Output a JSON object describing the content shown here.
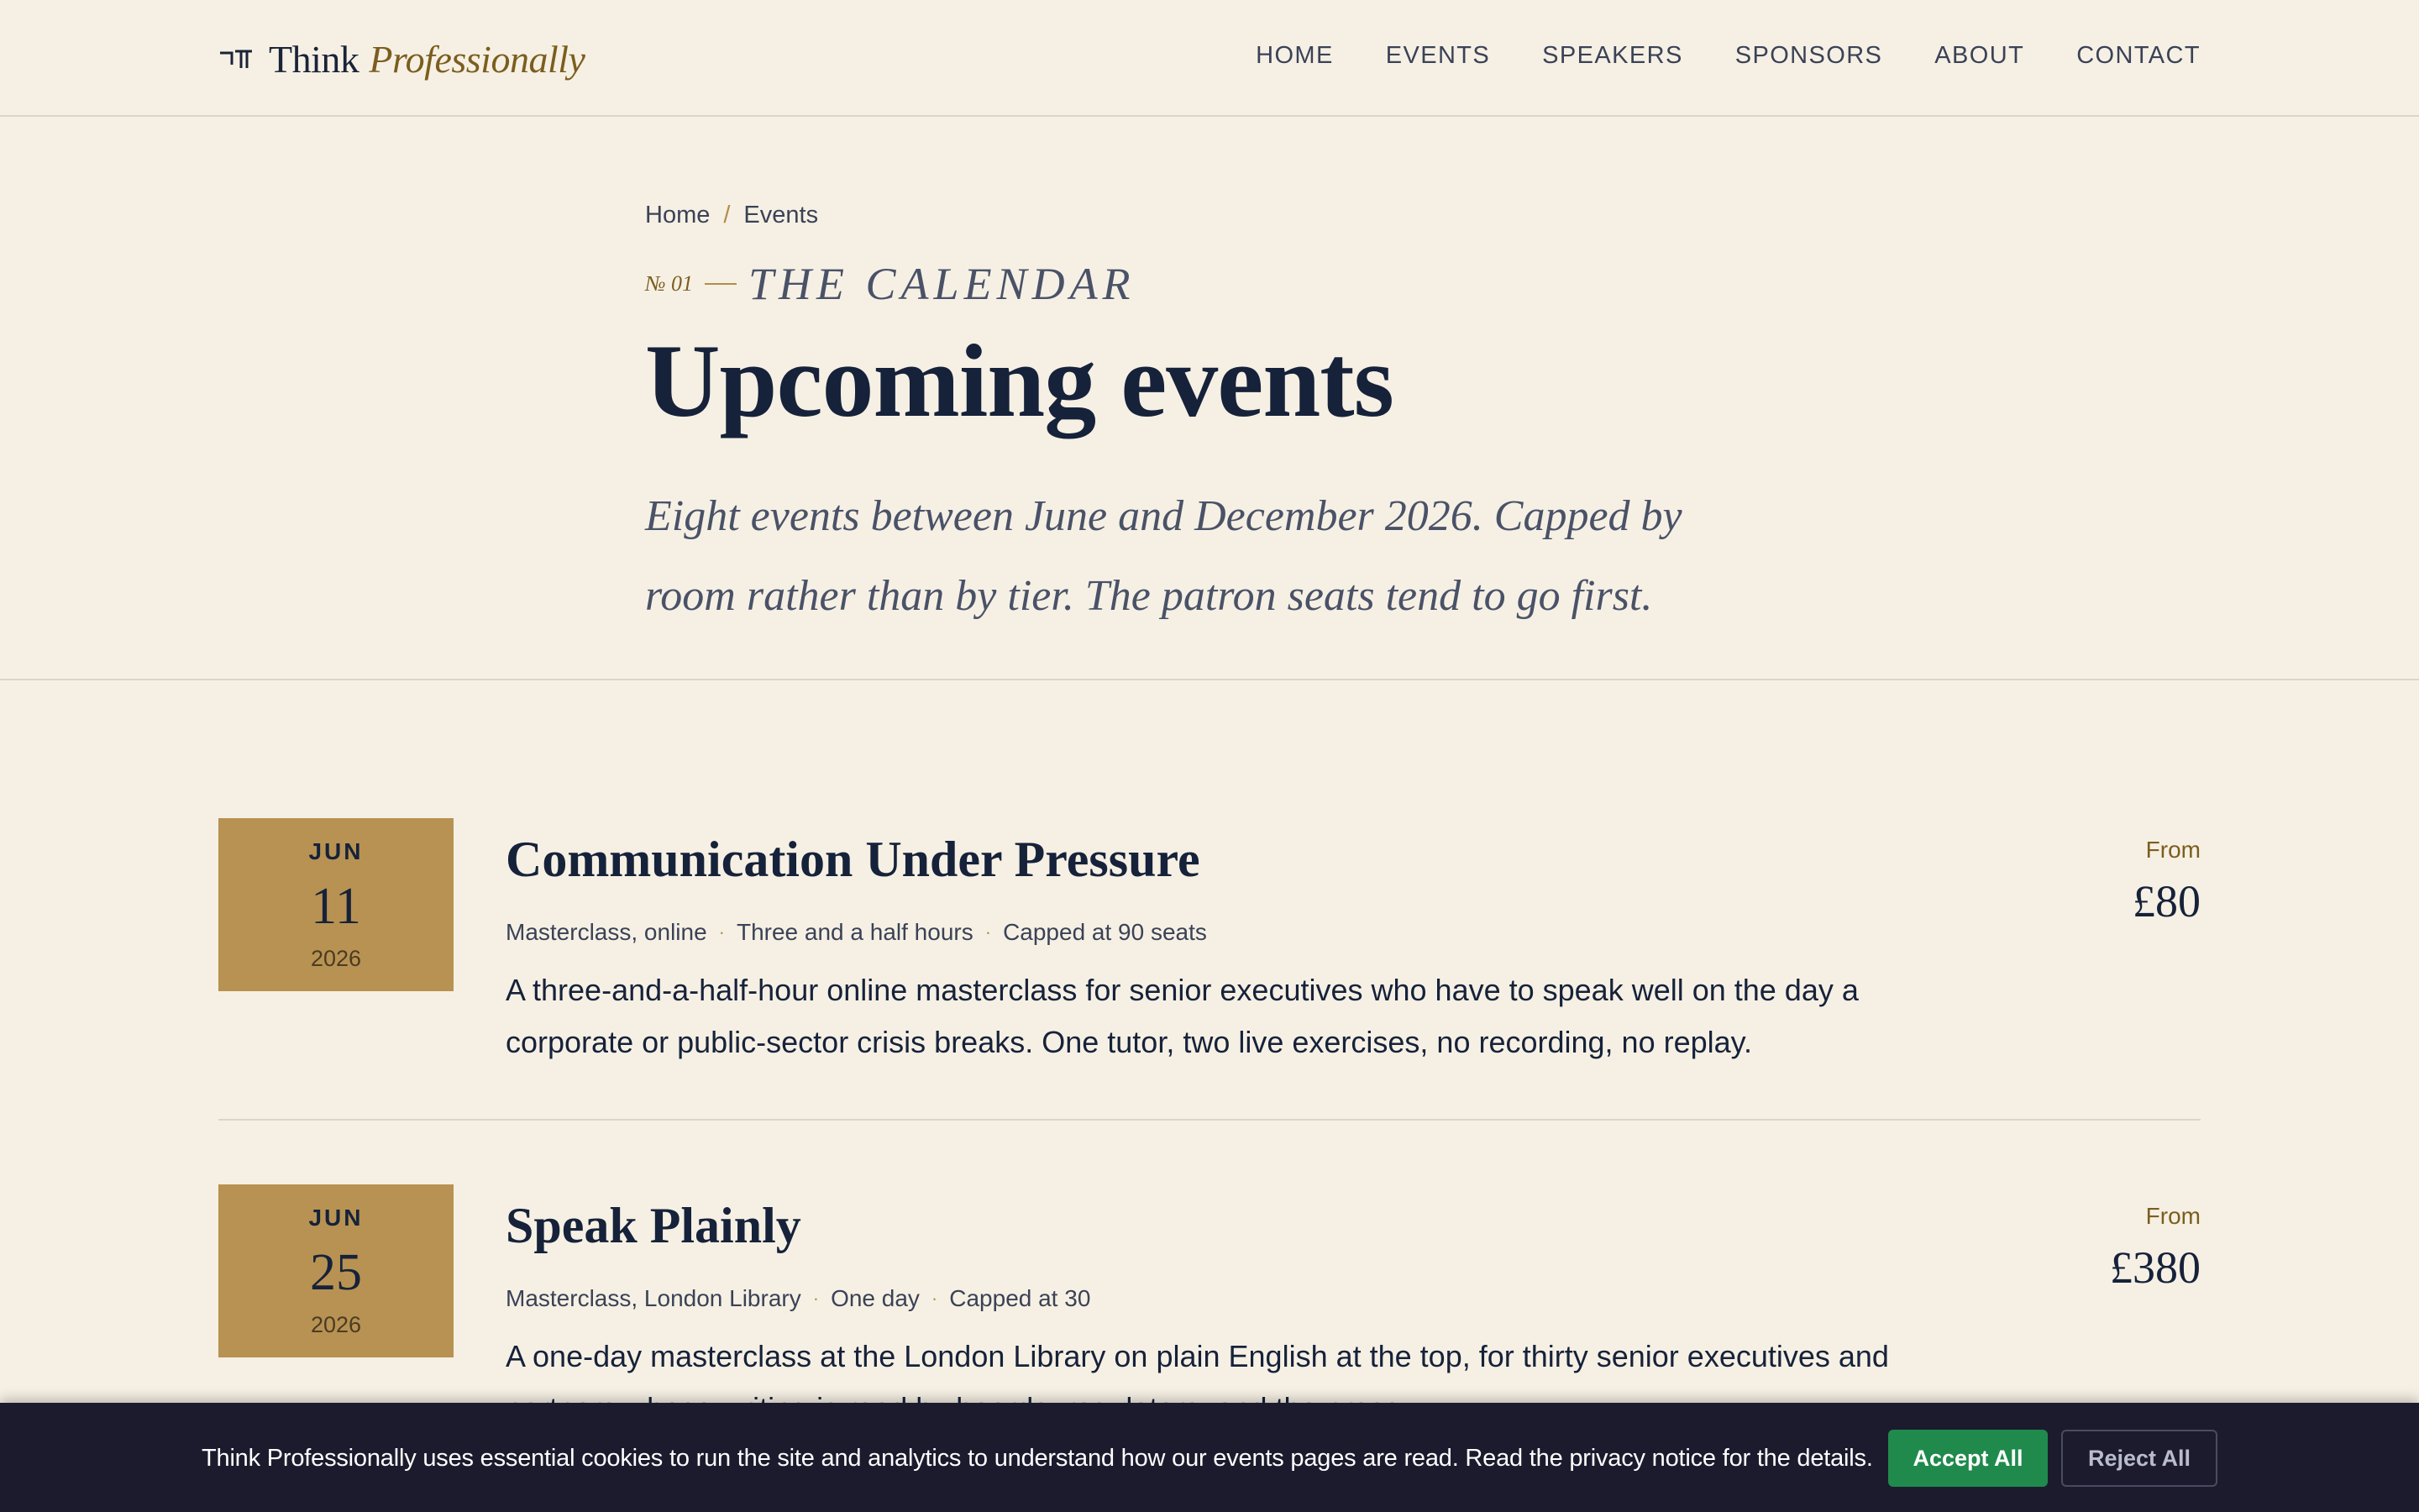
{
  "brand": {
    "name_first": "Think",
    "name_second": "Professionally",
    "mark_icon": "logo-mark-icon",
    "accent_color": "#b89252"
  },
  "nav": {
    "items": [
      {
        "label": "HOME"
      },
      {
        "label": "EVENTS"
      },
      {
        "label": "SPEAKERS"
      },
      {
        "label": "SPONSORS"
      },
      {
        "label": "ABOUT"
      },
      {
        "label": "CONTACT"
      }
    ]
  },
  "hero": {
    "breadcrumb": {
      "home": "Home",
      "separator": "/",
      "current": "Events"
    },
    "kicker_number": "№ 01",
    "kicker_label": "The Calendar",
    "title": "Upcoming events",
    "subtitle": "Eight events between June and December 2026. Capped by room rather than by tier. The patron seats tend to go first."
  },
  "events": [
    {
      "month": "JUN",
      "day": "11",
      "year": "2026",
      "title": "Communication Under Pressure",
      "meta": [
        "Masterclass, online",
        "Three and a half hours",
        "Capped at 90 seats"
      ],
      "description": "A three-and-a-half-hour online masterclass for senior executives who have to speak well on the day a corporate or public-sector crisis breaks. One tutor, two live exercises, no recording, no replay.",
      "price_label": "From",
      "price": "£80"
    },
    {
      "month": "JUN",
      "day": "25",
      "year": "2026",
      "title": "Speak Plainly",
      "meta": [
        "Masterclass, London Library",
        "One day",
        "Capped at 30"
      ],
      "description": "A one-day masterclass at the London Library on plain English at the top, for thirty senior executives and partners whose writing is read by boards, regulators, and the press.",
      "price_label": "From",
      "price": "£380"
    }
  ],
  "cookie": {
    "text": "Think Professionally uses essential cookies to run the site and analytics to understand how our events pages are read. Read the privacy notice for the details.",
    "accept_label": "Accept All",
    "reject_label": "Reject All",
    "accept_color": "#1f8a4c"
  }
}
